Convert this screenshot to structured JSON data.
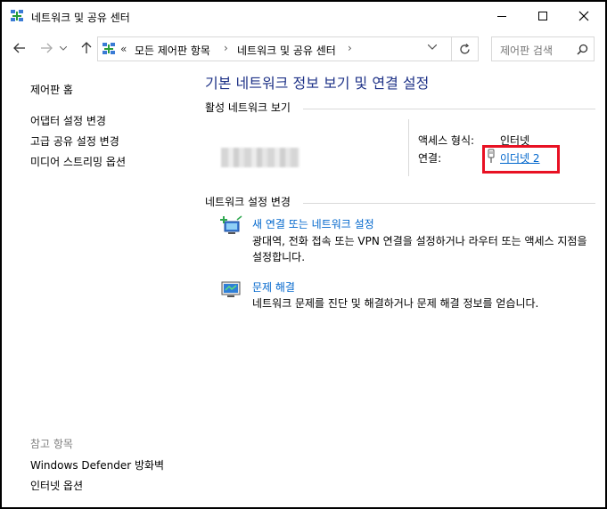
{
  "window": {
    "title": "네트워크 및 공유 센터"
  },
  "address_bar": {
    "overflow_chevron": "«",
    "breadcrumbs": [
      "모든 제어판 항목",
      "네트워크 및 공유 센터"
    ],
    "separator": "›",
    "search_placeholder": "제어판 검색"
  },
  "left_pane": {
    "home": "제어판 홈",
    "links": [
      "어댑터 설정 변경",
      "고급 공유 설정 변경",
      "미디어 스트리밍 옵션"
    ],
    "see_also_header": "참고 항목",
    "see_also": [
      "Windows Defender 방화벽",
      "인터넷 옵션"
    ]
  },
  "main": {
    "title": "기본 네트워크 정보 보기 및 연결 설정",
    "active_networks_header": "활성 네트워크 보기",
    "access_type_label": "액세스 형식:",
    "access_type_value": "인터넷",
    "connection_label": "연결:",
    "connection_value": "이더넷 2",
    "change_settings_header": "네트워크 설정 변경",
    "tasks": [
      {
        "link": "새 연결 또는 네트워크 설정",
        "description": "광대역, 전화 접속 또는 VPN 연결을 설정하거나 라우터 또는 액세스 지점을 설정합니다.",
        "icon": "new-connection-icon"
      },
      {
        "link": "문제 해결",
        "description": "네트워크 문제를 진단 및 해결하거나 문제 해결 정보를 얻습니다.",
        "icon": "troubleshoot-icon"
      }
    ]
  },
  "colors": {
    "title_blue": "#1e3287",
    "link_blue": "#0066cc",
    "highlight_red": "#e81123"
  }
}
